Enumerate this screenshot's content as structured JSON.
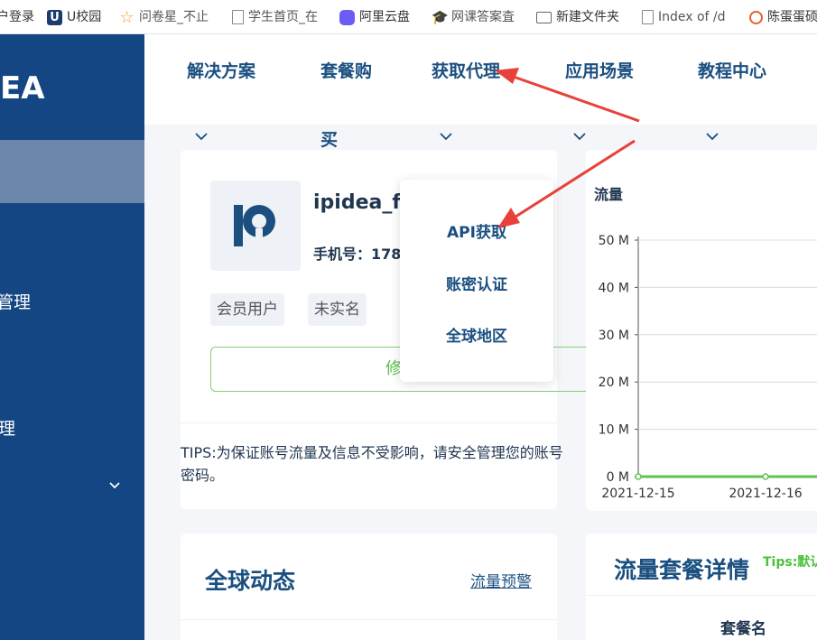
{
  "bookmarks": [
    {
      "label": "户登录",
      "icon": "none"
    },
    {
      "label": "U校园",
      "icon": "u-campus-icon"
    },
    {
      "label": "问卷星_不止",
      "icon": "star-icon"
    },
    {
      "label": "学生首页_在",
      "icon": "page-icon"
    },
    {
      "label": "阿里云盘",
      "icon": "cloud-drive-icon"
    },
    {
      "label": "网课答案査",
      "icon": "graduation-cap-icon"
    },
    {
      "label": "新建文件夹",
      "icon": "folder-icon"
    },
    {
      "label": "Index of /d",
      "icon": "page-icon"
    },
    {
      "label": "陈蛋蛋硕",
      "icon": "ring-icon"
    }
  ],
  "sidebar": {
    "logo": "EA",
    "items": [
      "管理",
      "理"
    ]
  },
  "topnav": {
    "items": [
      "解决方案",
      "套餐购",
      "获取代理",
      "应用场景",
      "教程中心"
    ],
    "wrap_text": "买"
  },
  "dropdown": {
    "items": [
      "API获取",
      "账密认证",
      "全球地区"
    ]
  },
  "profile": {
    "username": "ipidea_fa",
    "phone_label": "手机号：178",
    "tags": [
      "会员用户",
      "未实名"
    ],
    "edit_label": "修",
    "tips": "TIPS:为保证账号流量及信息不受影响，请安全管理您的账号密码。"
  },
  "chart_data": {
    "type": "line",
    "title": "流量",
    "x": [
      "2021-12-15",
      "2021-12-16"
    ],
    "series": [
      {
        "values": [
          0,
          0
        ]
      }
    ],
    "y_ticks": [
      "0 M",
      "10 M",
      "20 M",
      "30 M",
      "40 M",
      "50 M"
    ],
    "ylim": [
      0,
      50
    ],
    "grid": true,
    "color": "#62c34f"
  },
  "bottom": {
    "global_title": "全球动态",
    "alert_link": "流量预警",
    "package_title": "流量套餐详情",
    "tips_short": "Tips:默认",
    "column_header": "套餐名"
  },
  "colors": {
    "sidebar": "#134682",
    "sidebar_active": "#6b87ab",
    "accent": "#1a4f80",
    "green": "#62c34f",
    "arrow": "#e8413a"
  }
}
